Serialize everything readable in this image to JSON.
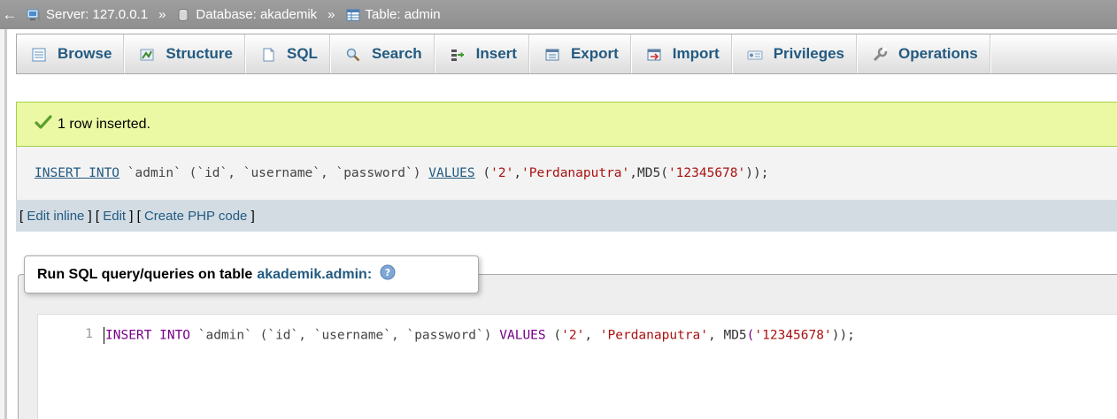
{
  "breadcrumb": {
    "back_glyph": "←",
    "server_label": "Server: 127.0.0.1",
    "database_label": "Database: akademik",
    "table_label": "Table: admin",
    "separator": "»"
  },
  "tabs": [
    {
      "label": "Browse",
      "icon": "browse-icon"
    },
    {
      "label": "Structure",
      "icon": "structure-icon"
    },
    {
      "label": "SQL",
      "icon": "sql-icon"
    },
    {
      "label": "Search",
      "icon": "search-icon"
    },
    {
      "label": "Insert",
      "icon": "insert-icon"
    },
    {
      "label": "Export",
      "icon": "export-icon"
    },
    {
      "label": "Import",
      "icon": "import-icon"
    },
    {
      "label": "Privileges",
      "icon": "privileges-icon"
    },
    {
      "label": "Operations",
      "icon": "operations-icon"
    }
  ],
  "message": {
    "text": "1 row inserted.",
    "icon": "check-icon"
  },
  "sql_echo": {
    "insert_into": "INSERT INTO",
    "table": "`admin`",
    "columns": "(`id`, `username`, `password`)",
    "values_kw": "VALUES",
    "open": "(",
    "val1": "'2'",
    "comma": ", ",
    "val2": "'Perdanaputra'",
    "md5": "MD5",
    "md5_open": "(",
    "val3": "'12345678'",
    "close": "));"
  },
  "links": {
    "edit_inline": "Edit inline",
    "edit": "Edit",
    "create_php": "Create PHP code"
  },
  "query_box": {
    "legend_prefix": "Run SQL query/queries on table",
    "legend_table": "akademik.admin:",
    "help_icon": "help-icon",
    "line_number": "1"
  },
  "colors": {
    "accent": "#235a81",
    "keyword": "#770088",
    "string": "#aa1111",
    "success_bg": "#ebf8a4"
  }
}
